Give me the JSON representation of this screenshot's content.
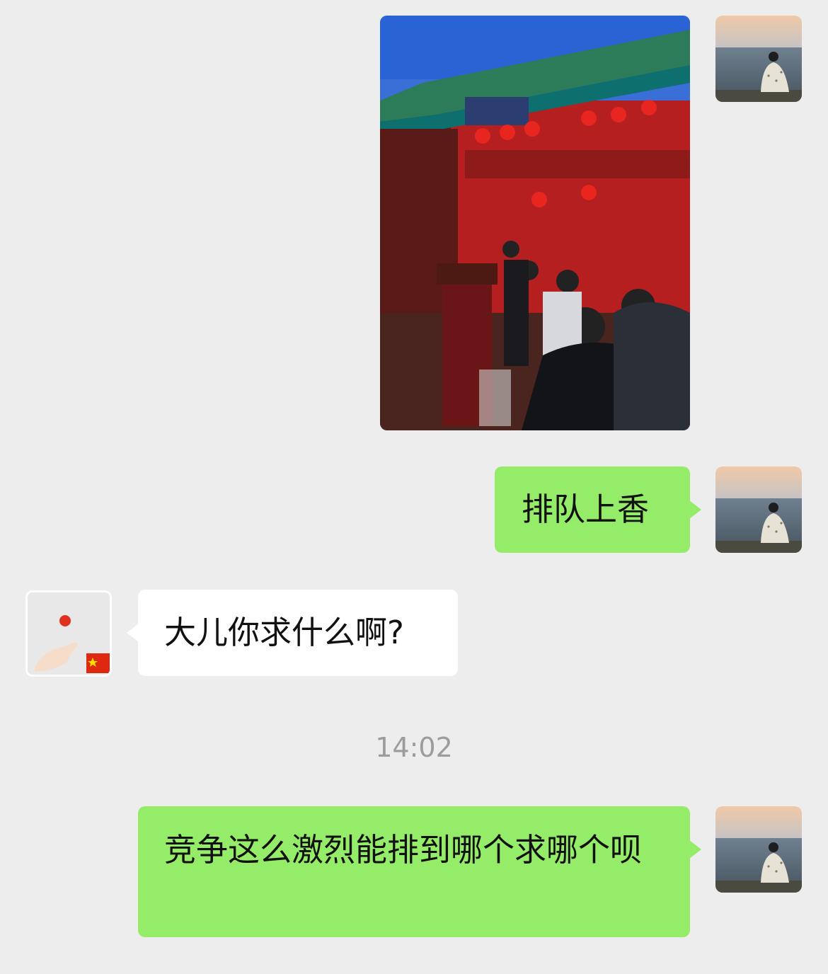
{
  "chat": {
    "messages": [
      {
        "sender": "self",
        "type": "image",
        "image_description": "temple-photo"
      },
      {
        "sender": "self",
        "type": "text",
        "text": "排队上香"
      },
      {
        "sender": "other",
        "type": "text",
        "text": "大儿你求什么啊?"
      },
      {
        "type": "timestamp",
        "text": "14:02"
      },
      {
        "sender": "self",
        "type": "text",
        "text": "竞争这么激烈能排到哪个求哪个呗"
      }
    ]
  },
  "colors": {
    "background": "#ededed",
    "self_bubble": "#95ec69",
    "other_bubble": "#ffffff",
    "timestamp_text": "#9c9c9c"
  }
}
